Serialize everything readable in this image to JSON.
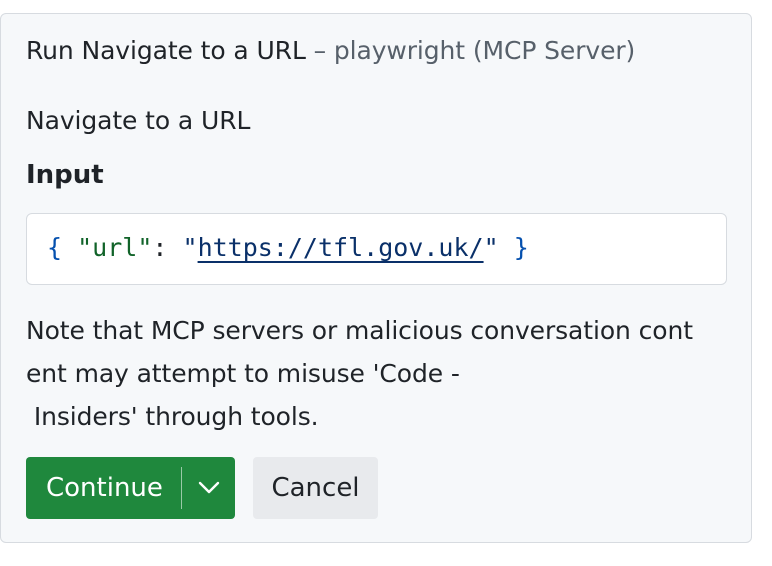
{
  "dialog": {
    "title_main": "Run Navigate to a URL",
    "title_separator": " – ",
    "title_sub": "playwright (MCP Server)",
    "description": "Navigate to a URL",
    "input_heading": "Input",
    "code": {
      "open_brace": "{",
      "key": "\"url\"",
      "colon": ":",
      "quote_open": "\"",
      "url": "https://tfl.gov.uk/",
      "quote_close": "\"",
      "close_brace": "}"
    },
    "note_lines": [
      "Note that MCP servers or malicious conversation cont",
      "ent may attempt to misuse 'Code -",
      " Insiders' through tools."
    ],
    "buttons": {
      "continue_label": "Continue",
      "cancel_label": "Cancel"
    },
    "icons": {
      "dropdown": "chevron-down-icon"
    },
    "colors": {
      "continue_bg": "#1f883d",
      "cancel_bg": "#e8eaed",
      "panel_bg": "#f6f8fa",
      "json_brace": "#0550ae",
      "json_key": "#116329",
      "json_string": "#0a3069"
    }
  }
}
